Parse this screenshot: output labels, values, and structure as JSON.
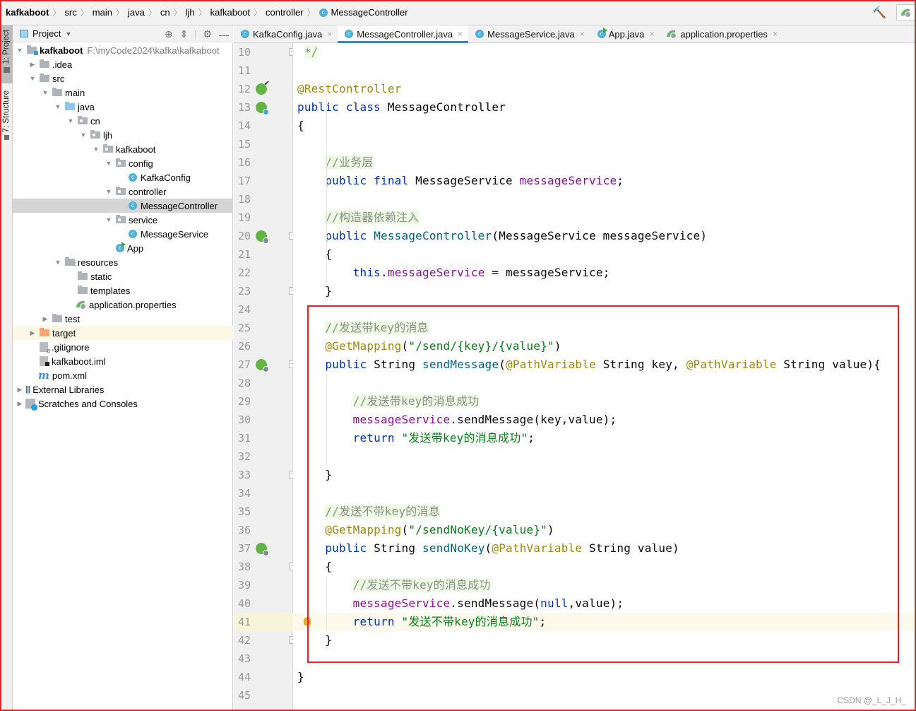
{
  "breadcrumb": {
    "items": [
      "kafkaboot",
      "src",
      "main",
      "java",
      "cn",
      "ljh",
      "kafkaboot",
      "controller"
    ],
    "current": "MessageController"
  },
  "toolbar": {
    "build_icon": "hammer-icon",
    "run_config_icon": "spring-boot-icon"
  },
  "left_stripe": {
    "project_label": "1: Project",
    "structure_label": "7: Structure"
  },
  "project_panel": {
    "title": "Project",
    "tool_icons": [
      "locate-icon",
      "collapse-all-icon",
      "gear-icon",
      "minimize-icon"
    ],
    "tree": [
      {
        "label": "kafkaboot",
        "path": "F:\\myCode2024\\kafka\\kafkaboot",
        "type": "module",
        "depth": 0,
        "expanded": true,
        "bold": true
      },
      {
        "label": ".idea",
        "type": "folder",
        "depth": 1,
        "expanded": false
      },
      {
        "label": "src",
        "type": "folder",
        "depth": 1,
        "expanded": true
      },
      {
        "label": "main",
        "type": "folder",
        "depth": 2,
        "expanded": true
      },
      {
        "label": "java",
        "type": "source-folder",
        "depth": 3,
        "expanded": true
      },
      {
        "label": "cn",
        "type": "package",
        "depth": 4,
        "expanded": true
      },
      {
        "label": "ljh",
        "type": "package",
        "depth": 5,
        "expanded": true
      },
      {
        "label": "kafkaboot",
        "type": "package",
        "depth": 6,
        "expanded": true
      },
      {
        "label": "config",
        "type": "package",
        "depth": 7,
        "expanded": true
      },
      {
        "label": "KafkaConfig",
        "type": "class",
        "depth": 8
      },
      {
        "label": "controller",
        "type": "package",
        "depth": 7,
        "expanded": true
      },
      {
        "label": "MessageController",
        "type": "class",
        "depth": 8,
        "selected": true
      },
      {
        "label": "service",
        "type": "package",
        "depth": 7,
        "expanded": true
      },
      {
        "label": "MessageService",
        "type": "class",
        "depth": 8
      },
      {
        "label": "App",
        "type": "app-class",
        "depth": 7
      },
      {
        "label": "resources",
        "type": "resources-folder",
        "depth": 3,
        "expanded": true
      },
      {
        "label": "static",
        "type": "folder-leaf",
        "depth": 4
      },
      {
        "label": "templates",
        "type": "folder-leaf",
        "depth": 4
      },
      {
        "label": "application.properties",
        "type": "spring-properties",
        "depth": 4
      },
      {
        "label": "test",
        "type": "folder",
        "depth": 2,
        "expanded": false
      },
      {
        "label": "target",
        "type": "target-folder",
        "depth": 1,
        "expanded": false,
        "highlight": true
      },
      {
        "label": ".gitignore",
        "type": "gitignore-file",
        "depth": 1
      },
      {
        "label": "kafkaboot.iml",
        "type": "iml-file",
        "depth": 1
      },
      {
        "label": "pom.xml",
        "type": "maven-file",
        "depth": 1
      },
      {
        "label": "External Libraries",
        "type": "libraries",
        "depth": 0,
        "expanded": false
      },
      {
        "label": "Scratches and Consoles",
        "type": "scratches",
        "depth": 0,
        "expanded": false
      }
    ]
  },
  "editor_tabs": [
    {
      "label": "KafkaConfig.java",
      "icon": "class-icon",
      "active": false
    },
    {
      "label": "MessageController.java",
      "icon": "class-icon",
      "active": true
    },
    {
      "label": "MessageService.java",
      "icon": "class-icon",
      "active": false
    },
    {
      "label": "App.java",
      "icon": "app-class-icon",
      "active": false
    },
    {
      "label": "application.properties",
      "icon": "spring-properties-icon",
      "active": false
    }
  ],
  "editor": {
    "current_line": 41,
    "lines": [
      {
        "n": 10,
        "tokens": [
          {
            "t": " */",
            "c": "cmt"
          }
        ],
        "fold": true
      },
      {
        "n": 11,
        "tokens": []
      },
      {
        "n": 12,
        "tokens": [
          {
            "t": "@RestController",
            "c": "ann"
          }
        ],
        "gutter_icon": "spring-bean-check-icon"
      },
      {
        "n": 13,
        "tokens": [
          {
            "t": "public class ",
            "c": "kw"
          },
          {
            "t": "MessageController",
            "c": ""
          }
        ],
        "gutter_icon": "spring-bean-class-icon"
      },
      {
        "n": 14,
        "tokens": [
          {
            "t": "{",
            "c": ""
          }
        ]
      },
      {
        "n": 15,
        "tokens": []
      },
      {
        "n": 16,
        "tokens": [
          {
            "t": "    ",
            "c": ""
          },
          {
            "t": "//业务层",
            "c": "cmt"
          }
        ]
      },
      {
        "n": 17,
        "tokens": [
          {
            "t": "    public final ",
            "c": "kw"
          },
          {
            "t": "MessageService ",
            "c": ""
          },
          {
            "t": "messageService",
            "c": "fld"
          },
          {
            "t": ";",
            "c": ""
          }
        ]
      },
      {
        "n": 18,
        "tokens": []
      },
      {
        "n": 19,
        "tokens": [
          {
            "t": "    ",
            "c": ""
          },
          {
            "t": "//构造器依赖注入",
            "c": "cmt"
          }
        ]
      },
      {
        "n": 20,
        "tokens": [
          {
            "t": "    public ",
            "c": "kw"
          },
          {
            "t": "MessageController",
            "c": "mth"
          },
          {
            "t": "(MessageService messageService)",
            "c": ""
          }
        ],
        "gutter_icon": "spring-inject-icon",
        "fold": true
      },
      {
        "n": 21,
        "tokens": [
          {
            "t": "    {",
            "c": ""
          }
        ]
      },
      {
        "n": 22,
        "tokens": [
          {
            "t": "        this",
            "c": "kw"
          },
          {
            "t": ".",
            "c": ""
          },
          {
            "t": "messageService",
            "c": "fld"
          },
          {
            "t": " = messageService;",
            "c": ""
          }
        ]
      },
      {
        "n": 23,
        "tokens": [
          {
            "t": "    }",
            "c": ""
          }
        ],
        "fold": true
      },
      {
        "n": 24,
        "tokens": []
      },
      {
        "n": 25,
        "tokens": [
          {
            "t": "    ",
            "c": ""
          },
          {
            "t": "//发送带key的消息",
            "c": "cmt"
          }
        ]
      },
      {
        "n": 26,
        "tokens": [
          {
            "t": "    @GetMapping",
            "c": "ann"
          },
          {
            "t": "(",
            "c": ""
          },
          {
            "t": "\"/send/{key}/{value}\"",
            "c": "str"
          },
          {
            "t": ")",
            "c": ""
          }
        ]
      },
      {
        "n": 27,
        "tokens": [
          {
            "t": "    public ",
            "c": "kw"
          },
          {
            "t": "String ",
            "c": ""
          },
          {
            "t": "sendMessage",
            "c": "mth"
          },
          {
            "t": "(",
            "c": ""
          },
          {
            "t": "@PathVariable",
            "c": "ann"
          },
          {
            "t": " String key, ",
            "c": ""
          },
          {
            "t": "@PathVariable",
            "c": "ann"
          },
          {
            "t": " String value){",
            "c": ""
          }
        ],
        "gutter_icon": "spring-web-endpoint-icon",
        "fold": true
      },
      {
        "n": 28,
        "tokens": []
      },
      {
        "n": 29,
        "tokens": [
          {
            "t": "        ",
            "c": ""
          },
          {
            "t": "//发送带key的消息成功",
            "c": "cmt"
          }
        ]
      },
      {
        "n": 30,
        "tokens": [
          {
            "t": "        ",
            "c": ""
          },
          {
            "t": "messageService",
            "c": "fld"
          },
          {
            "t": ".sendMessage(key,value);",
            "c": ""
          }
        ]
      },
      {
        "n": 31,
        "tokens": [
          {
            "t": "        return ",
            "c": "kw"
          },
          {
            "t": "\"发送带key的消息成功\"",
            "c": "str"
          },
          {
            "t": ";",
            "c": ""
          }
        ]
      },
      {
        "n": 32,
        "tokens": []
      },
      {
        "n": 33,
        "tokens": [
          {
            "t": "    }",
            "c": ""
          }
        ],
        "fold": true
      },
      {
        "n": 34,
        "tokens": []
      },
      {
        "n": 35,
        "tokens": [
          {
            "t": "    ",
            "c": ""
          },
          {
            "t": "//发送不带key的消息",
            "c": "cmt"
          }
        ]
      },
      {
        "n": 36,
        "tokens": [
          {
            "t": "    @GetMapping",
            "c": "ann"
          },
          {
            "t": "(",
            "c": ""
          },
          {
            "t": "\"/sendNoKey/{value}\"",
            "c": "str"
          },
          {
            "t": ")",
            "c": ""
          }
        ]
      },
      {
        "n": 37,
        "tokens": [
          {
            "t": "    public ",
            "c": "kw"
          },
          {
            "t": "String ",
            "c": ""
          },
          {
            "t": "sendNoKey",
            "c": "mth"
          },
          {
            "t": "(",
            "c": ""
          },
          {
            "t": "@PathVariable",
            "c": "ann"
          },
          {
            "t": " String value)",
            "c": ""
          }
        ],
        "gutter_icon": "spring-web-endpoint-icon"
      },
      {
        "n": 38,
        "tokens": [
          {
            "t": "    {",
            "c": ""
          }
        ],
        "fold": true
      },
      {
        "n": 39,
        "tokens": [
          {
            "t": "        ",
            "c": ""
          },
          {
            "t": "//发送不带key的消息成功",
            "c": "cmt"
          }
        ]
      },
      {
        "n": 40,
        "tokens": [
          {
            "t": "        ",
            "c": ""
          },
          {
            "t": "messageService",
            "c": "fld"
          },
          {
            "t": ".sendMessage(",
            "c": ""
          },
          {
            "t": "null",
            "c": "kw"
          },
          {
            "t": ",value);",
            "c": ""
          }
        ]
      },
      {
        "n": 41,
        "tokens": [
          {
            "t": "        return ",
            "c": "kw"
          },
          {
            "t": "\"发送不带key的消息成功\"",
            "c": "str"
          },
          {
            "t": ";",
            "c": ""
          }
        ],
        "intention_bulb": true
      },
      {
        "n": 42,
        "tokens": [
          {
            "t": "    }",
            "c": ""
          }
        ],
        "fold": true
      },
      {
        "n": 43,
        "tokens": []
      },
      {
        "n": 44,
        "tokens": [
          {
            "t": "}",
            "c": ""
          }
        ]
      },
      {
        "n": 45,
        "tokens": []
      }
    ]
  },
  "annotation_box": {
    "color": "#e0202a",
    "from_line": 24,
    "to_line": 43
  },
  "watermark": "CSDN @_L_J_H_",
  "colors": {
    "keyword": "#0033b3",
    "annotation": "#9e880d",
    "string": "#067d17",
    "field": "#871094",
    "method": "#00627a",
    "comment": "#8c8c8c",
    "selection": "#d5d5d5",
    "active_tab_underline": "#4083c9",
    "highlight_box": "#e0202a"
  }
}
